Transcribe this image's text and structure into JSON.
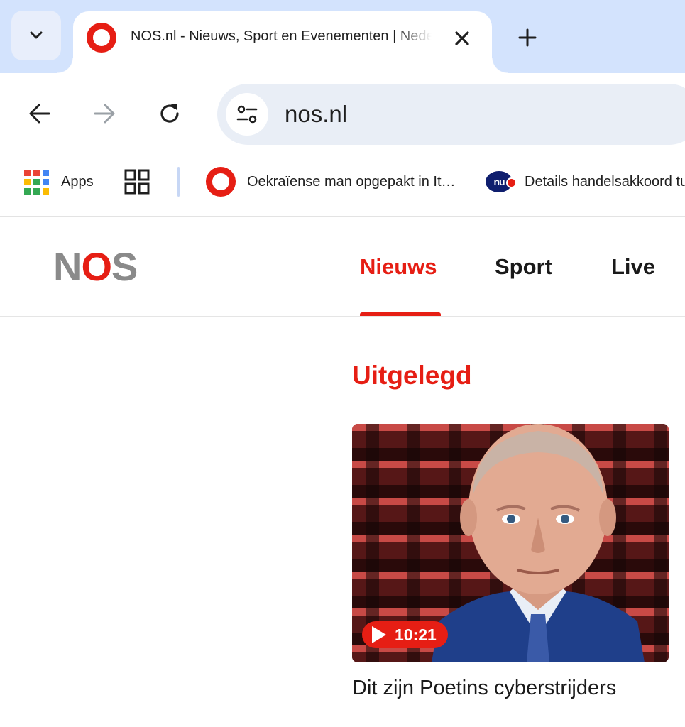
{
  "browser": {
    "tab": {
      "title": "NOS.nl - Nieuws, Sport en Evenementen | Nederland",
      "favicon": "nos-ring-icon"
    },
    "omnibox": {
      "url": "nos.nl"
    },
    "bookmarks": [
      {
        "label": "Apps",
        "icon": "apps-grid-icon"
      },
      {
        "label": "",
        "icon": "tab-groups-icon"
      },
      {
        "label": "Oekraïense man opgepakt in It…",
        "icon": "nos-ring-icon"
      },
      {
        "label": "Details handelsakkoord tu",
        "icon": "nu-nl-icon"
      }
    ]
  },
  "site": {
    "logo": {
      "pre": "N",
      "accent": "O",
      "post": "S"
    },
    "nav": [
      {
        "label": "Nieuws",
        "active": true
      },
      {
        "label": "Sport",
        "active": false
      },
      {
        "label": "Live",
        "active": false
      }
    ]
  },
  "content": {
    "section_title": "Uitgelegd",
    "card": {
      "duration": "10:21",
      "title": "Dit zijn Poetins cyberstrijders"
    }
  },
  "colors": {
    "brand_red": "#e61e14",
    "tabstrip": "#d3e3fd",
    "omnibox": "#e9eef6"
  }
}
